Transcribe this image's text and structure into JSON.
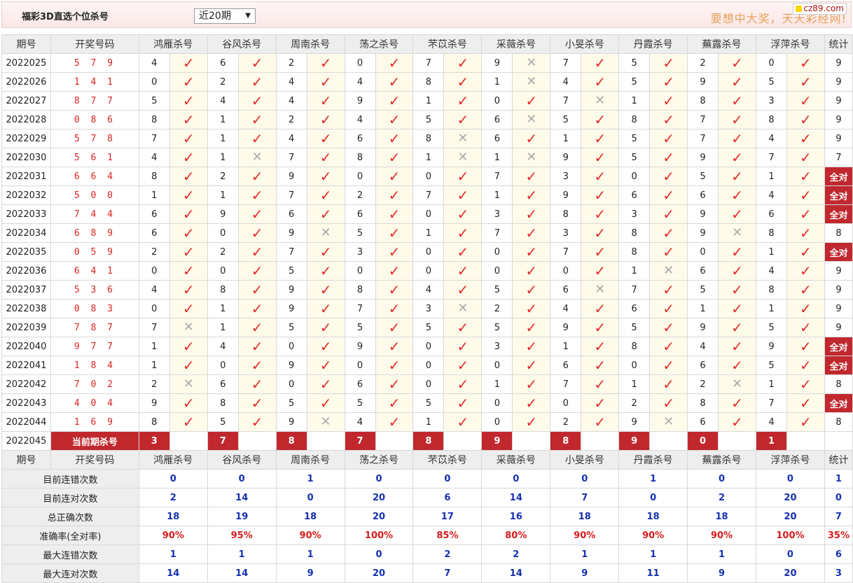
{
  "top": {
    "title": "福彩3D直选个位杀号",
    "period_select": "近20期",
    "select_arrow": "▼",
    "slogan": "要想中大奖，天天彩经网!",
    "logo": "cz89.com"
  },
  "headers": {
    "period": "期号",
    "numbers": "开奖号码",
    "stat": "统计",
    "experts": [
      "鸿雁杀号",
      "谷风杀号",
      "周南杀号",
      "荡之杀号",
      "芣苡杀号",
      "采薇杀号",
      "小旻杀号",
      "丹霞杀号",
      "蕪露杀号",
      "浮萍杀号"
    ]
  },
  "labels": {
    "check_glyph": "✓",
    "cross_glyph": "✕",
    "all_right": "全对",
    "current_kill": "当前期杀号"
  },
  "rows": [
    {
      "period": "2022025",
      "numbers": "5 7 9",
      "kills": [
        4,
        6,
        2,
        0,
        7,
        9,
        7,
        5,
        2,
        0
      ],
      "ok": [
        1,
        1,
        1,
        1,
        1,
        0,
        1,
        1,
        1,
        1
      ],
      "stat": "9"
    },
    {
      "period": "2022026",
      "numbers": "1 4 1",
      "kills": [
        0,
        2,
        4,
        4,
        8,
        1,
        4,
        5,
        9,
        5
      ],
      "ok": [
        1,
        1,
        1,
        1,
        1,
        0,
        1,
        1,
        1,
        1
      ],
      "stat": "9"
    },
    {
      "period": "2022027",
      "numbers": "8 7 7",
      "kills": [
        5,
        4,
        4,
        9,
        1,
        0,
        7,
        1,
        8,
        3
      ],
      "ok": [
        1,
        1,
        1,
        1,
        1,
        1,
        0,
        1,
        1,
        1
      ],
      "stat": "9"
    },
    {
      "period": "2022028",
      "numbers": "0 8 6",
      "kills": [
        8,
        1,
        2,
        4,
        5,
        6,
        5,
        8,
        7,
        8
      ],
      "ok": [
        1,
        1,
        1,
        1,
        1,
        0,
        1,
        1,
        1,
        1
      ],
      "stat": "9"
    },
    {
      "period": "2022029",
      "numbers": "5 7 8",
      "kills": [
        7,
        1,
        4,
        6,
        8,
        6,
        1,
        5,
        7,
        4
      ],
      "ok": [
        1,
        1,
        1,
        1,
        0,
        1,
        1,
        1,
        1,
        1
      ],
      "stat": "9"
    },
    {
      "period": "2022030",
      "numbers": "5 6 1",
      "kills": [
        4,
        1,
        7,
        8,
        1,
        1,
        9,
        5,
        9,
        7
      ],
      "ok": [
        1,
        0,
        1,
        1,
        0,
        0,
        1,
        1,
        1,
        1
      ],
      "stat": "7"
    },
    {
      "period": "2022031",
      "numbers": "6 6 4",
      "kills": [
        8,
        2,
        9,
        0,
        0,
        7,
        3,
        0,
        5,
        1
      ],
      "ok": [
        1,
        1,
        1,
        1,
        1,
        1,
        1,
        1,
        1,
        1
      ],
      "stat": "全对"
    },
    {
      "period": "2022032",
      "numbers": "5 0 0",
      "kills": [
        1,
        1,
        7,
        2,
        7,
        1,
        9,
        6,
        6,
        4
      ],
      "ok": [
        1,
        1,
        1,
        1,
        1,
        1,
        1,
        1,
        1,
        1
      ],
      "stat": "全对"
    },
    {
      "period": "2022033",
      "numbers": "7 4 4",
      "kills": [
        6,
        9,
        6,
        6,
        0,
        3,
        8,
        3,
        9,
        6
      ],
      "ok": [
        1,
        1,
        1,
        1,
        1,
        1,
        1,
        1,
        1,
        1
      ],
      "stat": "全对"
    },
    {
      "period": "2022034",
      "numbers": "6 8 9",
      "kills": [
        6,
        0,
        9,
        5,
        1,
        7,
        3,
        8,
        9,
        8
      ],
      "ok": [
        1,
        1,
        0,
        1,
        1,
        1,
        1,
        1,
        0,
        1
      ],
      "stat": "8"
    },
    {
      "period": "2022035",
      "numbers": "0 5 9",
      "kills": [
        2,
        2,
        7,
        3,
        0,
        0,
        7,
        8,
        0,
        1
      ],
      "ok": [
        1,
        1,
        1,
        1,
        1,
        1,
        1,
        1,
        1,
        1
      ],
      "stat": "全对"
    },
    {
      "period": "2022036",
      "numbers": "6 4 1",
      "kills": [
        0,
        0,
        5,
        0,
        0,
        0,
        0,
        1,
        6,
        4
      ],
      "ok": [
        1,
        1,
        1,
        1,
        1,
        1,
        1,
        0,
        1,
        1
      ],
      "stat": "9"
    },
    {
      "period": "2022037",
      "numbers": "5 3 6",
      "kills": [
        4,
        8,
        9,
        8,
        4,
        5,
        6,
        7,
        5,
        8
      ],
      "ok": [
        1,
        1,
        1,
        1,
        1,
        1,
        0,
        1,
        1,
        1
      ],
      "stat": "9"
    },
    {
      "period": "2022038",
      "numbers": "0 8 3",
      "kills": [
        0,
        1,
        9,
        7,
        3,
        2,
        4,
        6,
        1,
        1
      ],
      "ok": [
        1,
        1,
        1,
        1,
        0,
        1,
        1,
        1,
        1,
        1
      ],
      "stat": "9"
    },
    {
      "period": "2022039",
      "numbers": "7 8 7",
      "kills": [
        7,
        1,
        5,
        5,
        5,
        5,
        9,
        5,
        9,
        5
      ],
      "ok": [
        0,
        1,
        1,
        1,
        1,
        1,
        1,
        1,
        1,
        1
      ],
      "stat": "9"
    },
    {
      "period": "2022040",
      "numbers": "9 7 7",
      "kills": [
        1,
        4,
        0,
        9,
        0,
        3,
        1,
        8,
        4,
        9
      ],
      "ok": [
        1,
        1,
        1,
        1,
        1,
        1,
        1,
        1,
        1,
        1
      ],
      "stat": "全对"
    },
    {
      "period": "2022041",
      "numbers": "1 8 4",
      "kills": [
        1,
        0,
        9,
        0,
        0,
        0,
        6,
        0,
        6,
        5
      ],
      "ok": [
        1,
        1,
        1,
        1,
        1,
        1,
        1,
        1,
        1,
        1
      ],
      "stat": "全对"
    },
    {
      "period": "2022042",
      "numbers": "7 0 2",
      "kills": [
        2,
        6,
        0,
        6,
        0,
        1,
        7,
        1,
        2,
        1
      ],
      "ok": [
        0,
        1,
        1,
        1,
        1,
        1,
        1,
        1,
        0,
        1
      ],
      "stat": "8"
    },
    {
      "period": "2022043",
      "numbers": "4 0 4",
      "kills": [
        9,
        8,
        5,
        5,
        5,
        0,
        0,
        2,
        8,
        7
      ],
      "ok": [
        1,
        1,
        1,
        1,
        1,
        1,
        1,
        1,
        1,
        1
      ],
      "stat": "全对"
    },
    {
      "period": "2022044",
      "numbers": "1 6 9",
      "kills": [
        8,
        5,
        9,
        4,
        1,
        0,
        2,
        9,
        6,
        4
      ],
      "ok": [
        1,
        1,
        0,
        1,
        1,
        1,
        1,
        0,
        1,
        1
      ],
      "stat": "8"
    }
  ],
  "current": {
    "period": "2022045",
    "kills": [
      "3",
      "7",
      "8",
      "7",
      "8",
      "9",
      "8",
      "9",
      "0",
      "1"
    ]
  },
  "summary": [
    {
      "label": "目前连错次数",
      "values": [
        "0",
        "0",
        "1",
        "0",
        "0",
        "0",
        "0",
        "1",
        "0",
        "0"
      ],
      "stat": "1",
      "pct": false
    },
    {
      "label": "目前连对次数",
      "values": [
        "2",
        "14",
        "0",
        "20",
        "6",
        "14",
        "7",
        "0",
        "2",
        "20"
      ],
      "stat": "0",
      "pct": false
    },
    {
      "label": "总正确次数",
      "values": [
        "18",
        "19",
        "18",
        "20",
        "17",
        "16",
        "18",
        "18",
        "18",
        "20"
      ],
      "stat": "7",
      "pct": false
    },
    {
      "label": "准确率(全对率)",
      "values": [
        "90%",
        "95%",
        "90%",
        "100%",
        "85%",
        "80%",
        "90%",
        "90%",
        "90%",
        "100%"
      ],
      "stat": "35%",
      "pct": true
    },
    {
      "label": "最大连错次数",
      "values": [
        "1",
        "1",
        "1",
        "0",
        "2",
        "2",
        "1",
        "1",
        "1",
        "0"
      ],
      "stat": "6",
      "pct": false
    },
    {
      "label": "最大连对次数",
      "values": [
        "14",
        "14",
        "9",
        "20",
        "7",
        "14",
        "9",
        "11",
        "9",
        "20"
      ],
      "stat": "3",
      "pct": false
    }
  ],
  "colors": {
    "accent_red": "#c0282d",
    "check_red": "#e52a2a",
    "blue_value": "#1530b0",
    "slogan": "#e7a05a"
  }
}
